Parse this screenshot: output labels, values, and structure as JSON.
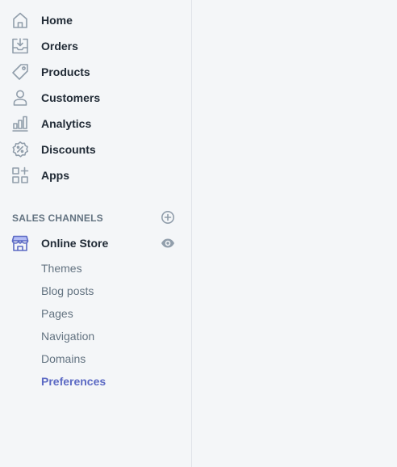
{
  "nav": {
    "items": [
      {
        "label": "Home",
        "icon": "home-icon"
      },
      {
        "label": "Orders",
        "icon": "orders-icon"
      },
      {
        "label": "Products",
        "icon": "tag-icon"
      },
      {
        "label": "Customers",
        "icon": "person-icon"
      },
      {
        "label": "Analytics",
        "icon": "bar-chart-icon"
      },
      {
        "label": "Discounts",
        "icon": "discount-icon"
      },
      {
        "label": "Apps",
        "icon": "apps-icon"
      }
    ]
  },
  "sales_channels": {
    "title": "SALES CHANNELS",
    "store": {
      "label": "Online Store",
      "icon": "storefront-icon"
    },
    "sub_items": [
      {
        "label": "Themes"
      },
      {
        "label": "Blog posts"
      },
      {
        "label": "Pages"
      },
      {
        "label": "Navigation"
      },
      {
        "label": "Domains"
      },
      {
        "label": "Preferences",
        "active": true
      }
    ]
  },
  "colors": {
    "background": "#f4f6f8",
    "text": "#212b36",
    "muted": "#637381",
    "icon": "#919eab",
    "accent": "#5c6ac4",
    "border": "#dfe3e8"
  }
}
